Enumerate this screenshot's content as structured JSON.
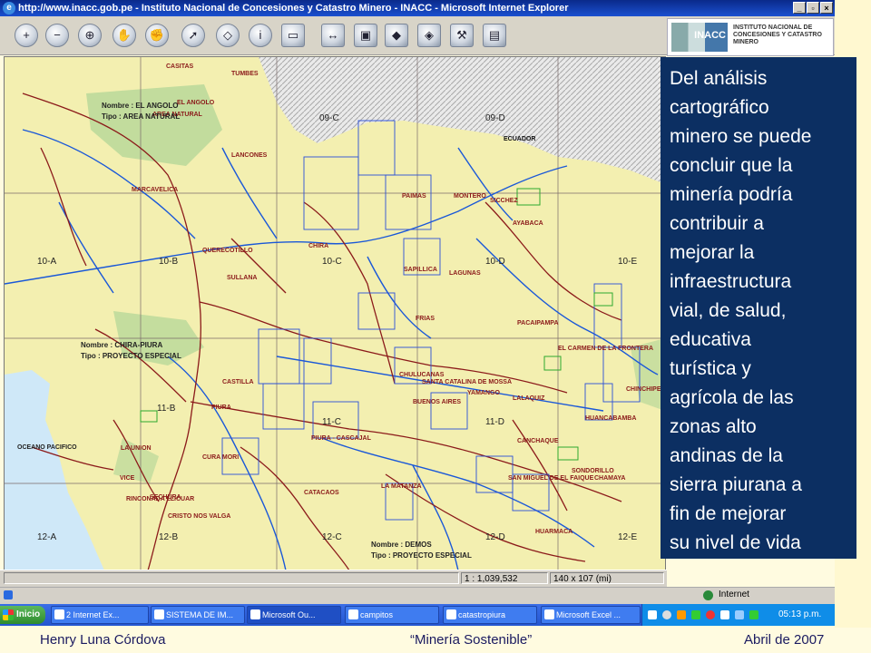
{
  "window": {
    "title": "http://www.inacc.gob.pe - Instituto Nacional de Concesiones y Catastro Minero - INACC - Microsoft Internet Explorer",
    "min": "_",
    "max": "▫",
    "close": "×"
  },
  "logo": {
    "mark_text": "INACC",
    "name": "INSTITUTO NACIONAL DE CONCESIONES Y CATASTRO MINERO"
  },
  "map": {
    "grid_labels": [
      "09-C",
      "09-D",
      "10-A",
      "10-B",
      "10-C",
      "10-D",
      "10-E",
      "11-B",
      "11-C",
      "11-D",
      "12-A",
      "12-B",
      "12-C",
      "12-D",
      "12-E"
    ],
    "places": [
      "TUMBES",
      "CASITAS",
      "EL ANGOLO",
      "AREA NATURAL",
      "ECUADOR",
      "LANCONES",
      "MARCAVELICA",
      "QUERECOTILLO",
      "SULLANA",
      "CHIRA",
      "MONTERO",
      "AYABACA",
      "PAIMAS",
      "SICCHEZ",
      "LAGUNAS",
      "SAPILLICA",
      "FRIAS",
      "PACAIPAMPA",
      "EL CARMEN DE LA FRONTERA",
      "CHINCHIPE",
      "CHULUCANAS",
      "SANTA CATALINA DE MOSSA",
      "YAMANGO",
      "LALAQUIZ",
      "CASTILLA",
      "PIURA",
      "BUENOS AIRES",
      "CANCHAQUE",
      "HUANCABAMBA",
      "LA UNION",
      "CURA MORI",
      "VICE",
      "PIURA - CASCAJAL",
      "CATACAOS",
      "LA MATANZA",
      "SAN MIGUEL DE EL FAIQUE",
      "CHAMAYA",
      "SONDORILLO",
      "HUARMACA",
      "SECHURA",
      "OCEANO PACIFICO",
      "RINCONADA LLICUAR",
      "CRISTO NOS VALGA",
      "CHIRA PIURA",
      "PROYECTO ESPECIAL",
      "DEMOS"
    ],
    "legend1": {
      "nombre": "Nombre : EL ANGOLO",
      "tipo": "Tipo : AREA NATURAL"
    },
    "legend2": {
      "nombre": "Nombre : CHIRA-PIURA",
      "tipo": "Tipo : PROYECTO ESPECIAL"
    },
    "legend3": {
      "nombre": "Nombre : DEMOS",
      "tipo": "Tipo : PROYECTO ESPECIAL"
    }
  },
  "status": {
    "scale": "1 : 1,039,532",
    "extent": "140 x 107 (mi)",
    "zone": "Internet"
  },
  "taskbar": {
    "start": "Inicio",
    "tasks": [
      "2 Internet Ex...",
      "SISTEMA DE IM...",
      "Microsoft Ou...",
      "campitos",
      "catastropiura",
      "Microsoft Excel ..."
    ],
    "time": "05:13 p.m."
  },
  "textbox": {
    "lines": [
      "Del análisis",
      "cartográfico",
      "minero se puede",
      "concluir que la",
      "minería podría",
      "contribuir a",
      "mejorar la",
      "infraestructura",
      "vial, de salud,",
      "educativa",
      "turística y",
      "agrícola de las",
      "zonas alto",
      "andinas de la",
      "sierra piurana a",
      "fin de mejorar",
      "su nivel de vida"
    ]
  },
  "footer": {
    "author": "Henry Luna Córdova",
    "title": "“Minería Sostenible”",
    "date": "Abril de 2007"
  },
  "colors": {
    "titlebar": "#0a2a8a",
    "textbox": "#0c2f62",
    "map_land": "#f3efb0",
    "river": "#1a58d8",
    "road": "#8b1a1a",
    "concession": "#2a4fd8",
    "green_area": "#b8d89a",
    "sea": "#cfe8f8"
  }
}
